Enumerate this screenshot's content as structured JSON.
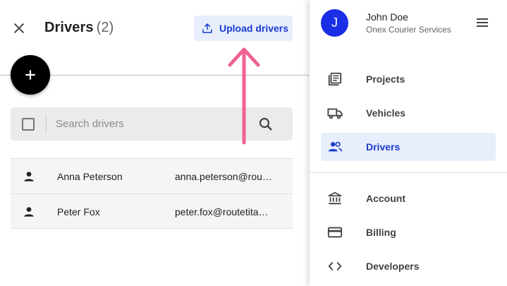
{
  "header": {
    "title": "Drivers",
    "count": "(2)",
    "upload_label": "Upload drivers"
  },
  "search": {
    "placeholder": "Search drivers"
  },
  "drivers": [
    {
      "name": "Anna Peterson",
      "email": "anna.peterson@routetitan.com"
    },
    {
      "name": "Peter Fox",
      "email": "peter.fox@routetitan.com"
    }
  ],
  "drawer": {
    "user": {
      "initial": "J",
      "name": "John Doe",
      "company": "Onex Courier Services"
    },
    "nav_items": [
      {
        "label": "Projects",
        "icon": "projects-icon"
      },
      {
        "label": "Vehicles",
        "icon": "truck-icon"
      },
      {
        "label": "Drivers",
        "icon": "people-icon",
        "active": true
      }
    ],
    "account_items": [
      {
        "label": "Account",
        "icon": "bank-icon"
      },
      {
        "label": "Billing",
        "icon": "credit-card-icon"
      },
      {
        "label": "Developers",
        "icon": "code-icon"
      }
    ]
  },
  "colors": {
    "accent": "#1a3ccf",
    "accent_light": "#e8eefc",
    "avatar": "#1a2ee6",
    "annotation_arrow": "#f06292"
  }
}
